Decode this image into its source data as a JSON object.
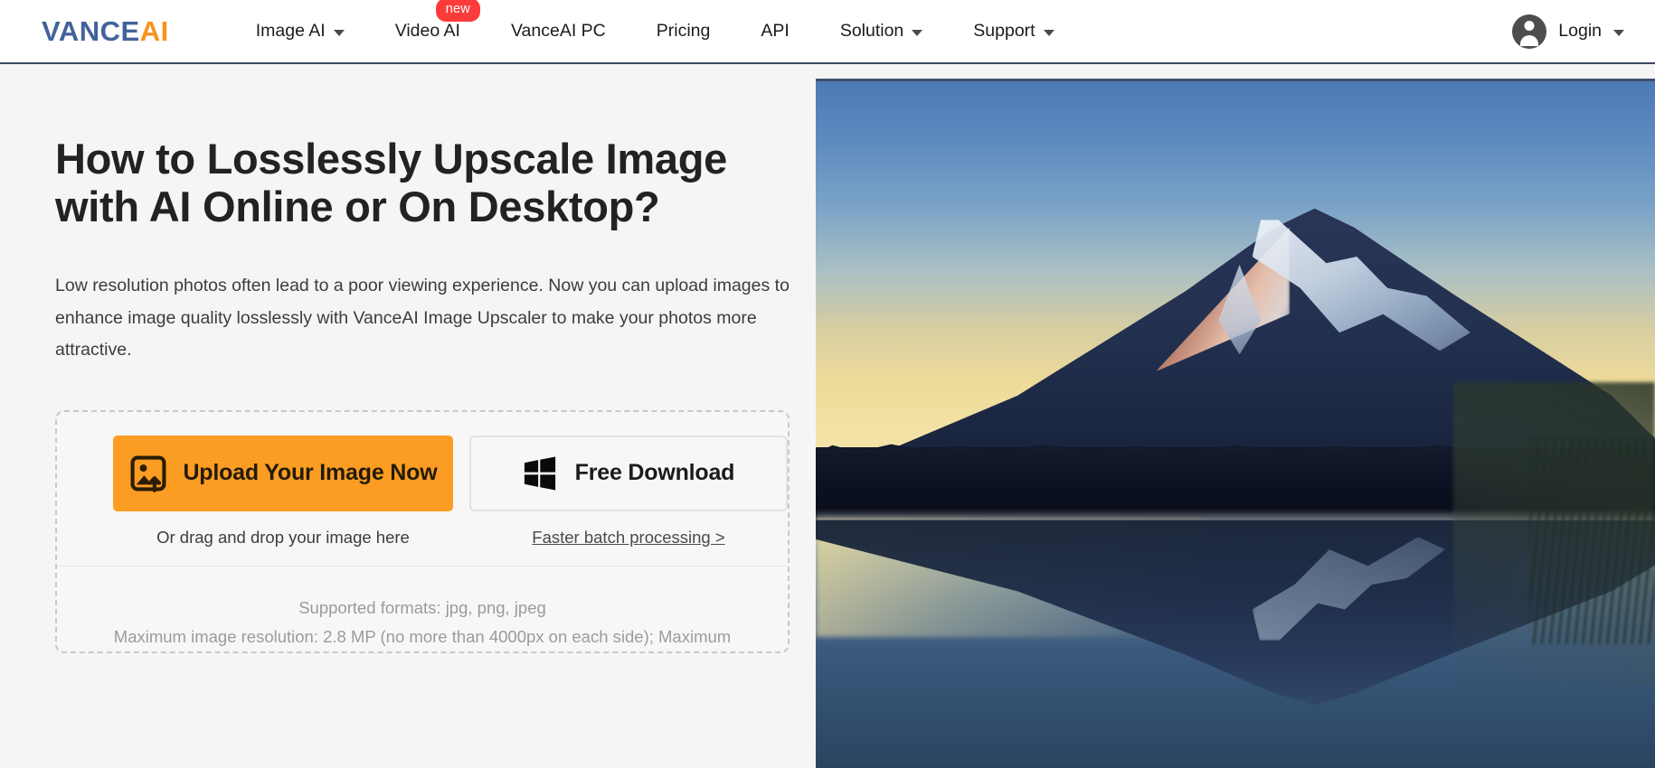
{
  "header": {
    "logo": {
      "part1": "VANCE",
      "part2": "AI"
    },
    "nav": [
      {
        "label": "Image AI",
        "has_caret": true,
        "badge": null
      },
      {
        "label": "Video AI",
        "has_caret": false,
        "badge": "new"
      },
      {
        "label": "VanceAI PC",
        "has_caret": false,
        "badge": null
      },
      {
        "label": "Pricing",
        "has_caret": false,
        "badge": null
      },
      {
        "label": "API",
        "has_caret": false,
        "badge": null
      },
      {
        "label": "Solution",
        "has_caret": true,
        "badge": null
      },
      {
        "label": "Support",
        "has_caret": true,
        "badge": null
      }
    ],
    "account": {
      "label": "Login",
      "icon": "user-avatar-icon"
    },
    "border_color": "#3b4a5e"
  },
  "hero": {
    "title": "How to Losslessly Upscale Image with AI Online or On Desktop?",
    "description": "Low resolution photos often lead to a poor viewing experience. Now you can upload images to enhance image quality losslessly with VanceAI Image Upscaler to make your photos more attractive."
  },
  "upload": {
    "primary_button": {
      "label": "Upload Your Image Now",
      "icon": "image-upload-icon",
      "color": "#fb9d23"
    },
    "secondary_button": {
      "label": "Free Download",
      "icon": "windows-icon"
    },
    "drag_hint": "Or drag and drop your image here",
    "batch_link": "Faster batch processing >",
    "formats": "Supported formats: jpg, png, jpeg",
    "limits": "Maximum image resolution: 2.8 MP (no more than 4000px on each side); Maximum"
  },
  "hero_image": {
    "alt": "Mount Fuji at sunrise reflected in a calm lake",
    "sky_top_color": "#4b79b4",
    "sky_bottom_color": "#f3e3a6",
    "water_color": "#3c5a7d"
  }
}
